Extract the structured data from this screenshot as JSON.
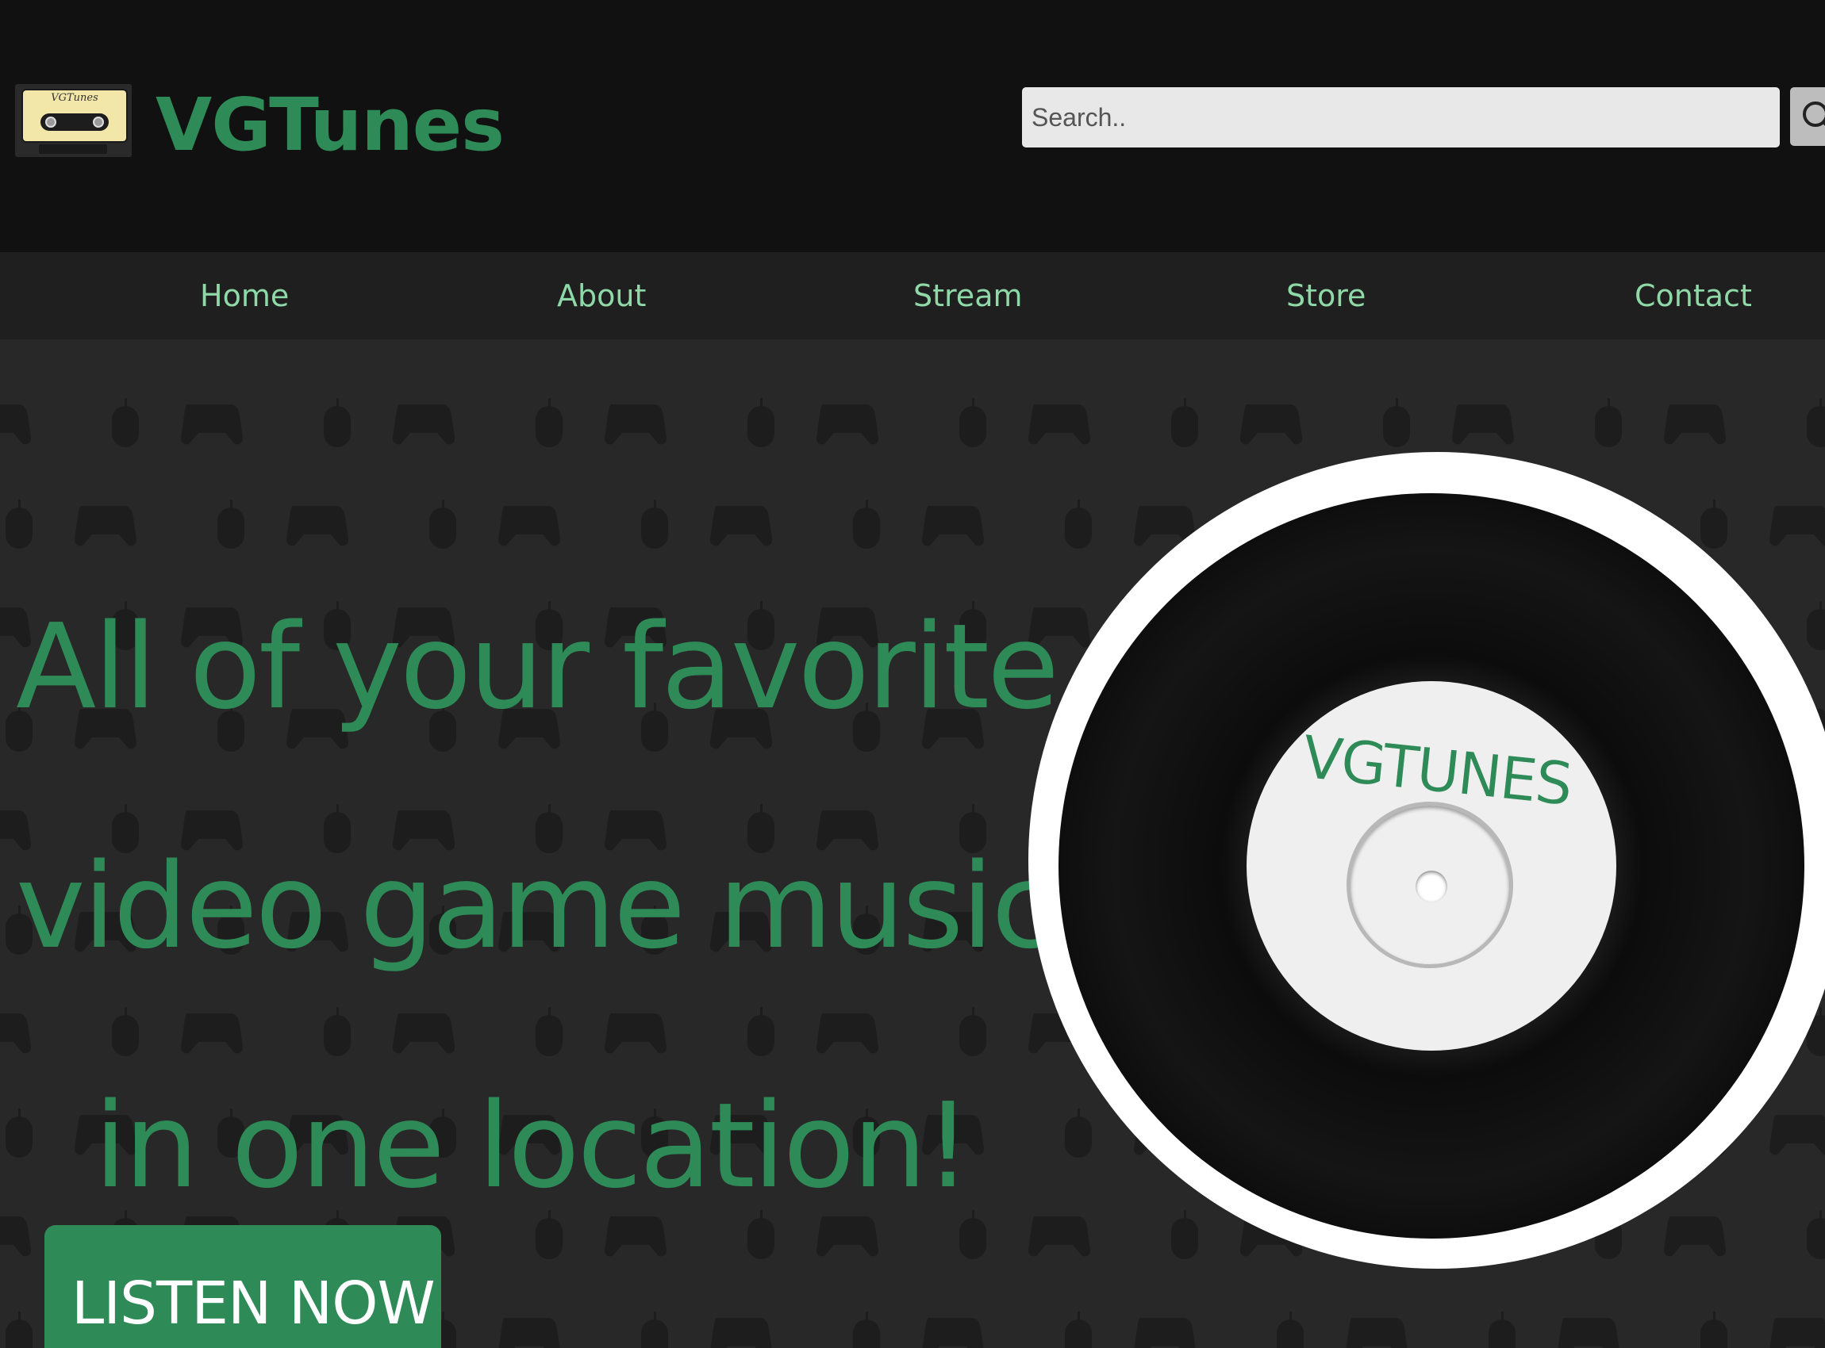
{
  "header": {
    "logo_label": "VGTunes",
    "brand": "VGTunes",
    "search": {
      "placeholder": "Search..",
      "value": ""
    },
    "search_icon": "search-icon"
  },
  "nav": {
    "items": [
      {
        "label": "Home"
      },
      {
        "label": "About"
      },
      {
        "label": "Stream"
      },
      {
        "label": "Store"
      },
      {
        "label": "Contact"
      }
    ]
  },
  "hero": {
    "headline": [
      "All of your favorite",
      "video game music",
      "in one location!"
    ],
    "cta_label": "LISTEN NOW",
    "record_label": "VGTUNES",
    "background_icons": [
      "gamepad-icon",
      "mouse-icon"
    ]
  },
  "colors": {
    "accent": "#2e8b57",
    "nav_text": "#8fd9a8",
    "header_bg": "#111111",
    "nav_bg": "#1f1f1f",
    "page_bg": "#282828"
  }
}
